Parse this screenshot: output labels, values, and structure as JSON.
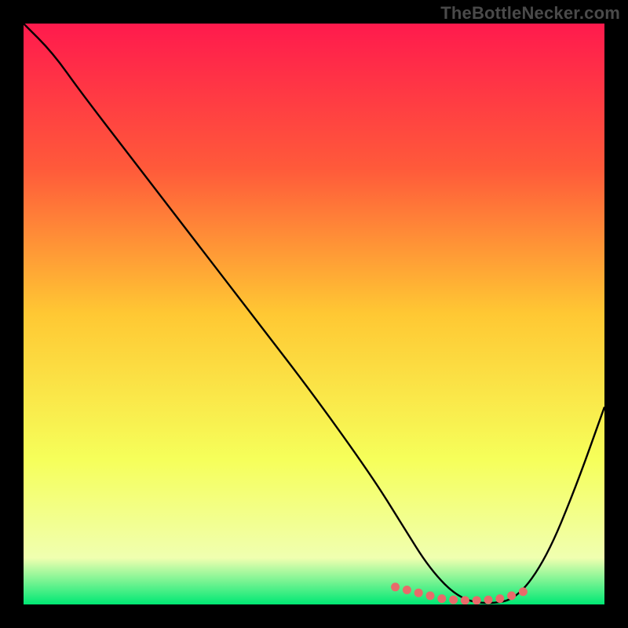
{
  "watermark": "TheBottleNecker.com",
  "chart_data": {
    "type": "line",
    "title": "",
    "xlabel": "",
    "ylabel": "",
    "xlim": [
      0,
      100
    ],
    "ylim": [
      0,
      100
    ],
    "gradient_stops": [
      {
        "offset": 0,
        "color": "#ff1a4d"
      },
      {
        "offset": 25,
        "color": "#ff5a3a"
      },
      {
        "offset": 50,
        "color": "#ffc833"
      },
      {
        "offset": 75,
        "color": "#f6ff5a"
      },
      {
        "offset": 92,
        "color": "#f0ffb0"
      },
      {
        "offset": 100,
        "color": "#00e874"
      }
    ],
    "series": [
      {
        "name": "bottleneck-curve",
        "x": [
          0,
          5,
          10,
          20,
          30,
          40,
          50,
          60,
          65,
          70,
          75,
          80,
          85,
          90,
          95,
          100
        ],
        "y": [
          100,
          95,
          88,
          75,
          62,
          49,
          36,
          22,
          14,
          6,
          1,
          0,
          1,
          8,
          20,
          34
        ]
      }
    ],
    "markers": {
      "name": "highlight-dots",
      "color": "#e86a6a",
      "x": [
        64,
        66,
        68,
        70,
        72,
        74,
        76,
        78,
        80,
        82,
        84,
        86
      ],
      "y": [
        3,
        2.5,
        2,
        1.5,
        1,
        0.8,
        0.7,
        0.7,
        0.8,
        1,
        1.5,
        2.2
      ]
    }
  }
}
